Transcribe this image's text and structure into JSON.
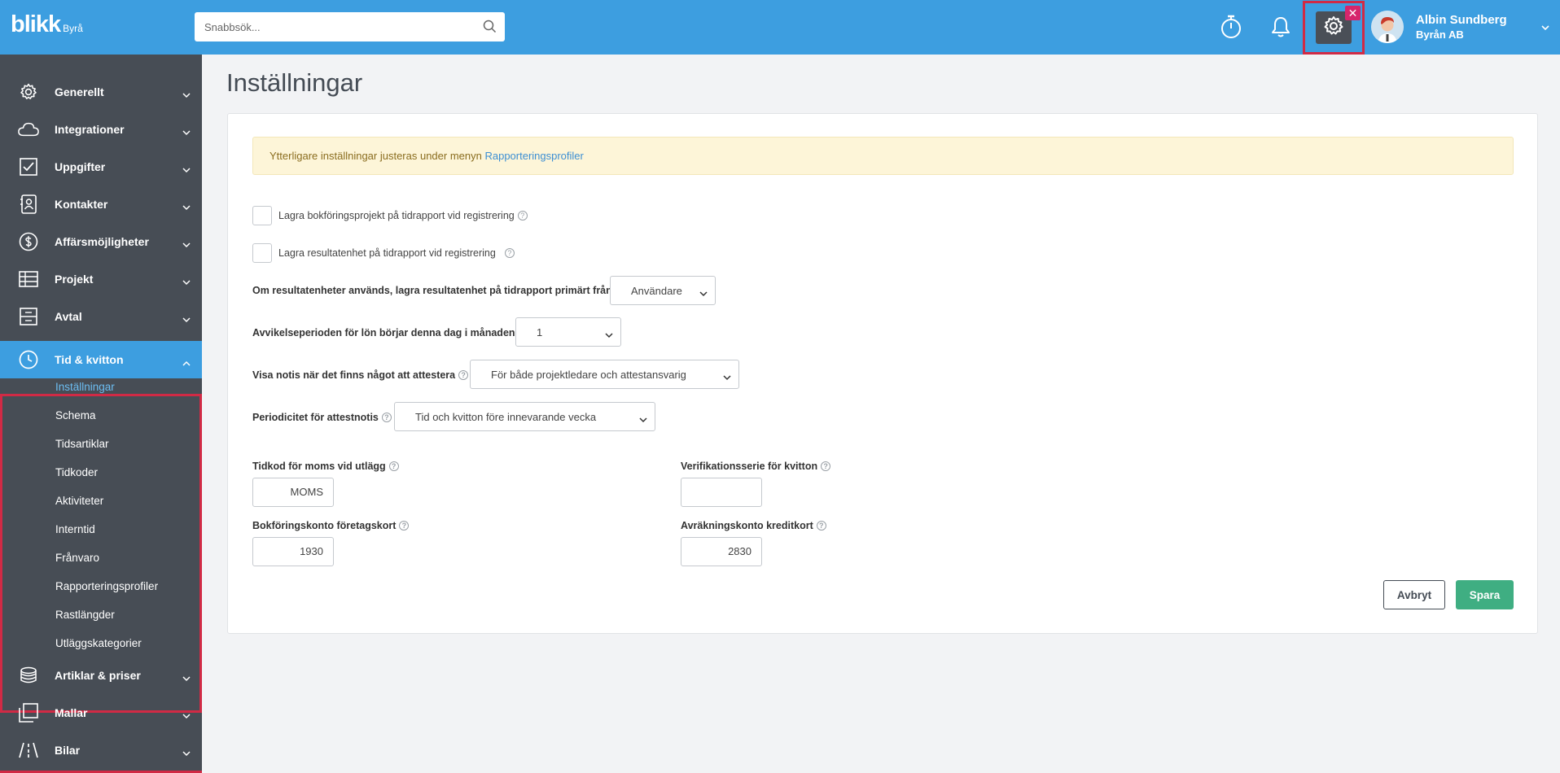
{
  "brand": {
    "logo": "blikk",
    "sub": "Byrå"
  },
  "search": {
    "placeholder": "Snabbsök..."
  },
  "user": {
    "name": "Albin Sundberg",
    "org": "Byrån AB"
  },
  "gear_badge": "✕",
  "sidebar": {
    "items": [
      {
        "label": "Generellt",
        "icon": "gear-icon"
      },
      {
        "label": "Integrationer",
        "icon": "cloud-icon"
      },
      {
        "label": "Uppgifter",
        "icon": "checkbox-icon"
      },
      {
        "label": "Kontakter",
        "icon": "contact-card-icon"
      },
      {
        "label": "Affärsmöjligheter",
        "icon": "dollar-icon"
      },
      {
        "label": "Projekt",
        "icon": "table-icon"
      },
      {
        "label": "Avtal",
        "icon": "archive-icon"
      },
      {
        "label": "Tid & kvitton",
        "icon": "clock-icon"
      },
      {
        "label": "Artiklar & priser",
        "icon": "coins-icon"
      },
      {
        "label": "Mallar",
        "icon": "copy-icon"
      },
      {
        "label": "Bilar",
        "icon": "road-icon"
      }
    ],
    "sub": [
      "Inställningar",
      "Schema",
      "Tidsartiklar",
      "Tidkoder",
      "Aktiviteter",
      "Interntid",
      "Frånvaro",
      "Rapporteringsprofiler",
      "Rastlängder",
      "Utläggskategorier"
    ]
  },
  "page": {
    "title": "Inställningar"
  },
  "notice": {
    "text": "Ytterligare inställningar justeras under menyn ",
    "link": "Rapporteringsprofiler"
  },
  "form": {
    "chk1": "Lagra bokföringsprojekt på tidrapport vid registrering",
    "chk2": "Lagra resultatenhet på tidrapport vid registrering",
    "res_label": "Om resultatenheter används, lagra resultatenhet på tidrapport primärt från",
    "res_value": "Användare",
    "avv_label": "Avvikelseperioden för lön börjar denna dag i månaden",
    "avv_value": "1",
    "notis_label": "Visa notis när det finns något att attestera",
    "notis_value": "För både projektledare och attestansvarig",
    "period_label": "Periodicitet för attestnotis",
    "period_value": "Tid och kvitton före innevarande vecka",
    "tidkod_label": "Tidkod för moms vid utlägg",
    "tidkod_value": "MOMS",
    "verif_label": "Verifikationsserie för kvitton",
    "verif_value": "",
    "bokf_label": "Bokföringskonto företagskort",
    "bokf_value": "1930",
    "avr_label": "Avräkningskonto kreditkort",
    "avr_value": "2830",
    "help": "?"
  },
  "buttons": {
    "cancel": "Avbryt",
    "save": "Spara"
  }
}
